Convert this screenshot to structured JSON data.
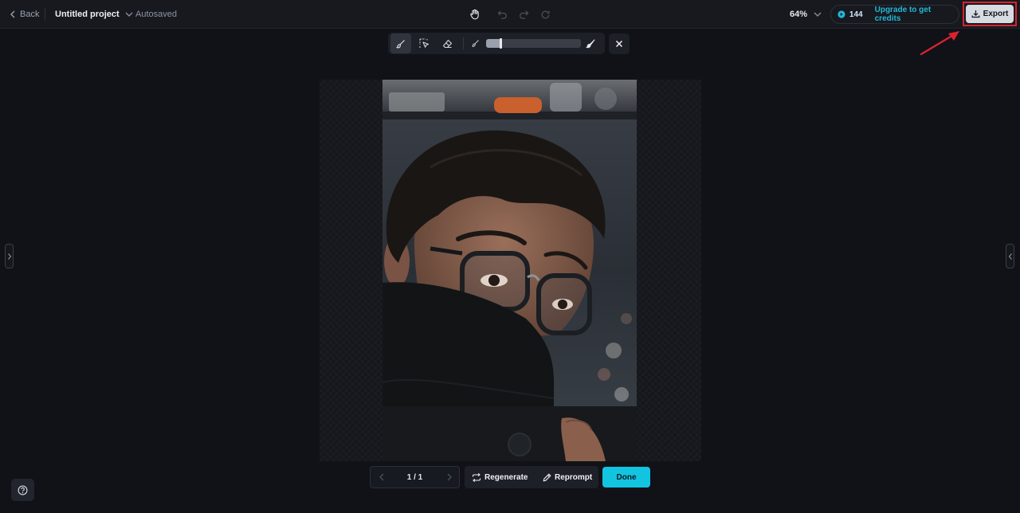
{
  "header": {
    "back_label": "Back",
    "project_name": "Untitled project",
    "save_status": "Autosaved",
    "zoom_level": "64%",
    "credits_count": "144",
    "upgrade_label": "Upgrade to get credits",
    "export_label": "Export"
  },
  "toolbar": {
    "active_tool": "brush",
    "brush_size_percent": 15
  },
  "canvas": {
    "icons": [
      "brush-icon",
      "select-brush-icon",
      "eraser-icon",
      "small-brush-icon",
      "large-brush-icon",
      "close-icon"
    ]
  },
  "footer": {
    "page_indicator": "1 / 1",
    "regenerate_label": "Regenerate",
    "reprompt_label": "Reprompt",
    "done_label": "Done"
  },
  "colors": {
    "accent": "#12c4e0",
    "upgrade_link": "#22b8d6",
    "highlight_frame": "#d8232f"
  }
}
